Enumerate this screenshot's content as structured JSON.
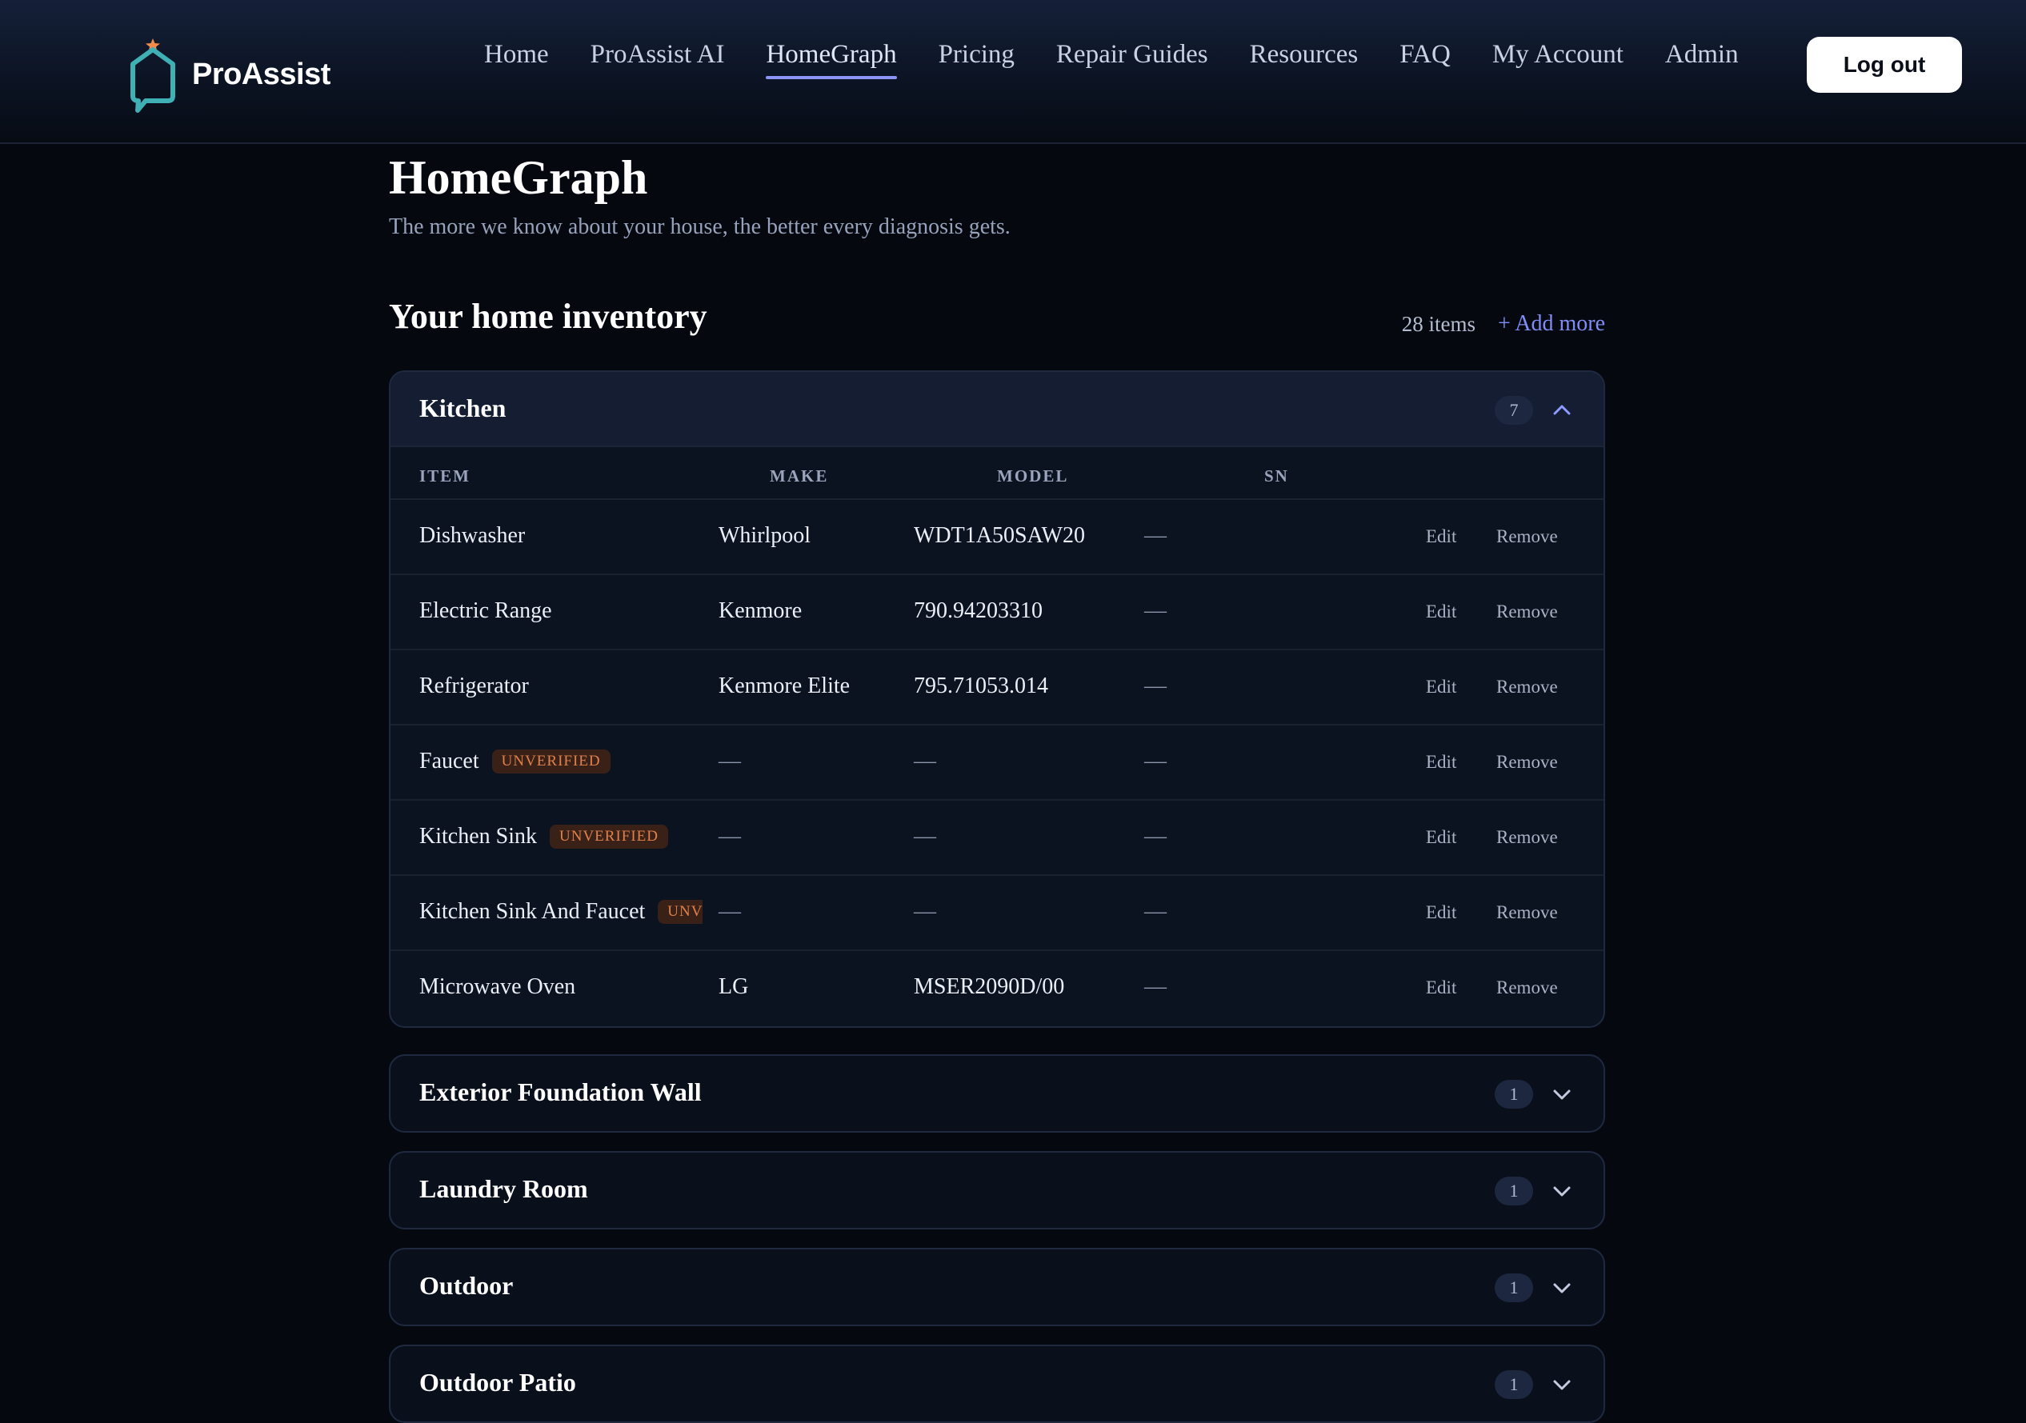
{
  "brand": {
    "name": "ProAssist",
    "accent": "#3fb0b4",
    "star": "#f28a4b"
  },
  "nav": {
    "items": [
      {
        "label": "Home"
      },
      {
        "label": "ProAssist AI"
      },
      {
        "label": "HomeGraph",
        "active": true
      },
      {
        "label": "Pricing"
      },
      {
        "label": "Repair Guides"
      },
      {
        "label": "Resources"
      },
      {
        "label": "FAQ"
      },
      {
        "label": "My Account"
      },
      {
        "label": "Admin"
      }
    ],
    "logout_label": "Log out"
  },
  "page": {
    "title": "HomeGraph",
    "subtitle": "The more we know about your house, the better every diagnosis gets."
  },
  "inventory": {
    "title": "Your home inventory",
    "count_label": "28 items",
    "add_more_label": "+ Add more",
    "columns": {
      "item": "ITEM",
      "make": "MAKE",
      "model": "MODEL",
      "sn": "SN"
    },
    "action_labels": {
      "edit": "Edit",
      "remove": "Remove"
    },
    "unverified_label": "UNVERIFIED",
    "sections": [
      {
        "name": "Kitchen",
        "count": "7",
        "expanded": true,
        "rows": [
          {
            "item": "Dishwasher",
            "make": "Whirlpool",
            "model": "WDT1A50SAW20",
            "sn": "—",
            "unverified": false
          },
          {
            "item": "Electric Range",
            "make": "Kenmore",
            "model": "790.94203310",
            "sn": "—",
            "unverified": false
          },
          {
            "item": "Refrigerator",
            "make": "Kenmore Elite",
            "model": "795.71053.014",
            "sn": "—",
            "unverified": false
          },
          {
            "item": "Faucet",
            "make": "—",
            "model": "—",
            "sn": "—",
            "unverified": true
          },
          {
            "item": "Kitchen Sink",
            "make": "—",
            "model": "—",
            "sn": "—",
            "unverified": true
          },
          {
            "item": "Kitchen Sink And Faucet",
            "make": "—",
            "model": "—",
            "sn": "—",
            "unverified": true
          },
          {
            "item": "Microwave Oven",
            "make": "LG",
            "model": "MSER2090D/00",
            "sn": "—",
            "unverified": false
          }
        ]
      },
      {
        "name": "Exterior Foundation Wall",
        "count": "1",
        "expanded": false
      },
      {
        "name": "Laundry Room",
        "count": "1",
        "expanded": false
      },
      {
        "name": "Outdoor",
        "count": "1",
        "expanded": false
      },
      {
        "name": "Outdoor Patio",
        "count": "1",
        "expanded": false
      }
    ]
  }
}
